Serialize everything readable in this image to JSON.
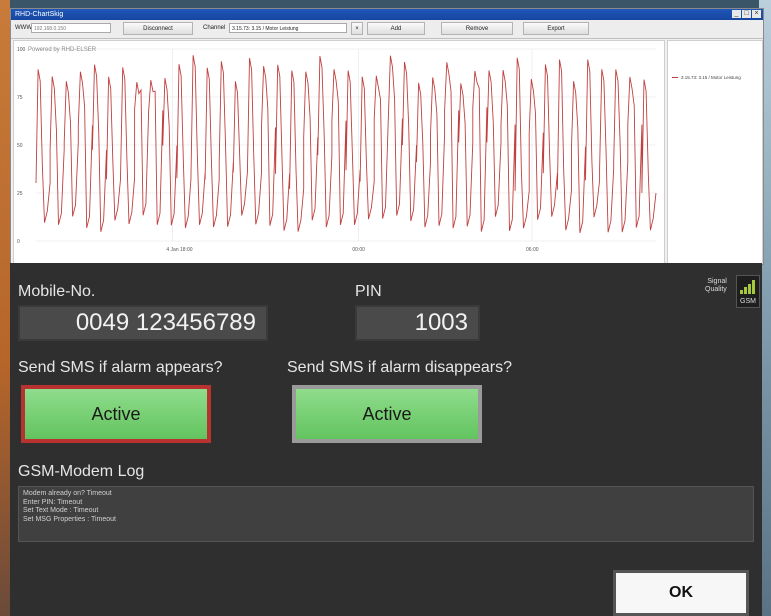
{
  "window": {
    "title": "RHD-ChartSkig",
    "toolbar": {
      "www_label": "WWW:",
      "address_value": "192.168.0.150",
      "disconnect_label": "Disconnect",
      "channel_label": "Channel",
      "channel_value": "3.15.73: 3.15 / Motor Leistung",
      "add_label": "Add",
      "remove_label": "Remove",
      "export_label": "Export"
    },
    "watermark": "Powered by RHD-ELSER",
    "legend_entry": "3.15.73: 3.15 / Motor Leistung",
    "x_ticks": [
      "4 Jan 18:00",
      "00:00",
      "06:00"
    ],
    "y_ticks": [
      "100",
      "75",
      "50",
      "25",
      "0"
    ]
  },
  "chart_data": {
    "type": "line",
    "series": [
      {
        "name": "3.15.73: 3.15 / Motor Leistung",
        "color": "#c04040"
      }
    ],
    "yticks": [
      100,
      75,
      50,
      25,
      0
    ],
    "ylim": [
      0,
      100
    ],
    "grid": true,
    "legend_placement": "right"
  },
  "panel": {
    "mobile_label": "Mobile-No.",
    "mobile_value": "0049 123456789",
    "pin_label": "PIN",
    "pin_value": "1003",
    "signal_label_1": "Signal",
    "signal_label_2": "Quality",
    "gsm_label": "GSM",
    "appear_label": "Send SMS if alarm appears?",
    "disappear_label": "Send SMS if alarm disappears?",
    "appear_button": "Active",
    "disappear_button": "Active",
    "log_title": "GSM-Modem Log",
    "log_lines": [
      "Modem already on? Timeout",
      "Enter PIN: Timeout",
      "Set Text Mode : Timeout",
      "Set MSG Properties : Timeout"
    ],
    "ok_label": "OK"
  },
  "colors": {
    "accent_green": "#6fcf6b",
    "alarm_red": "#b8322f",
    "line": "#c04040"
  }
}
